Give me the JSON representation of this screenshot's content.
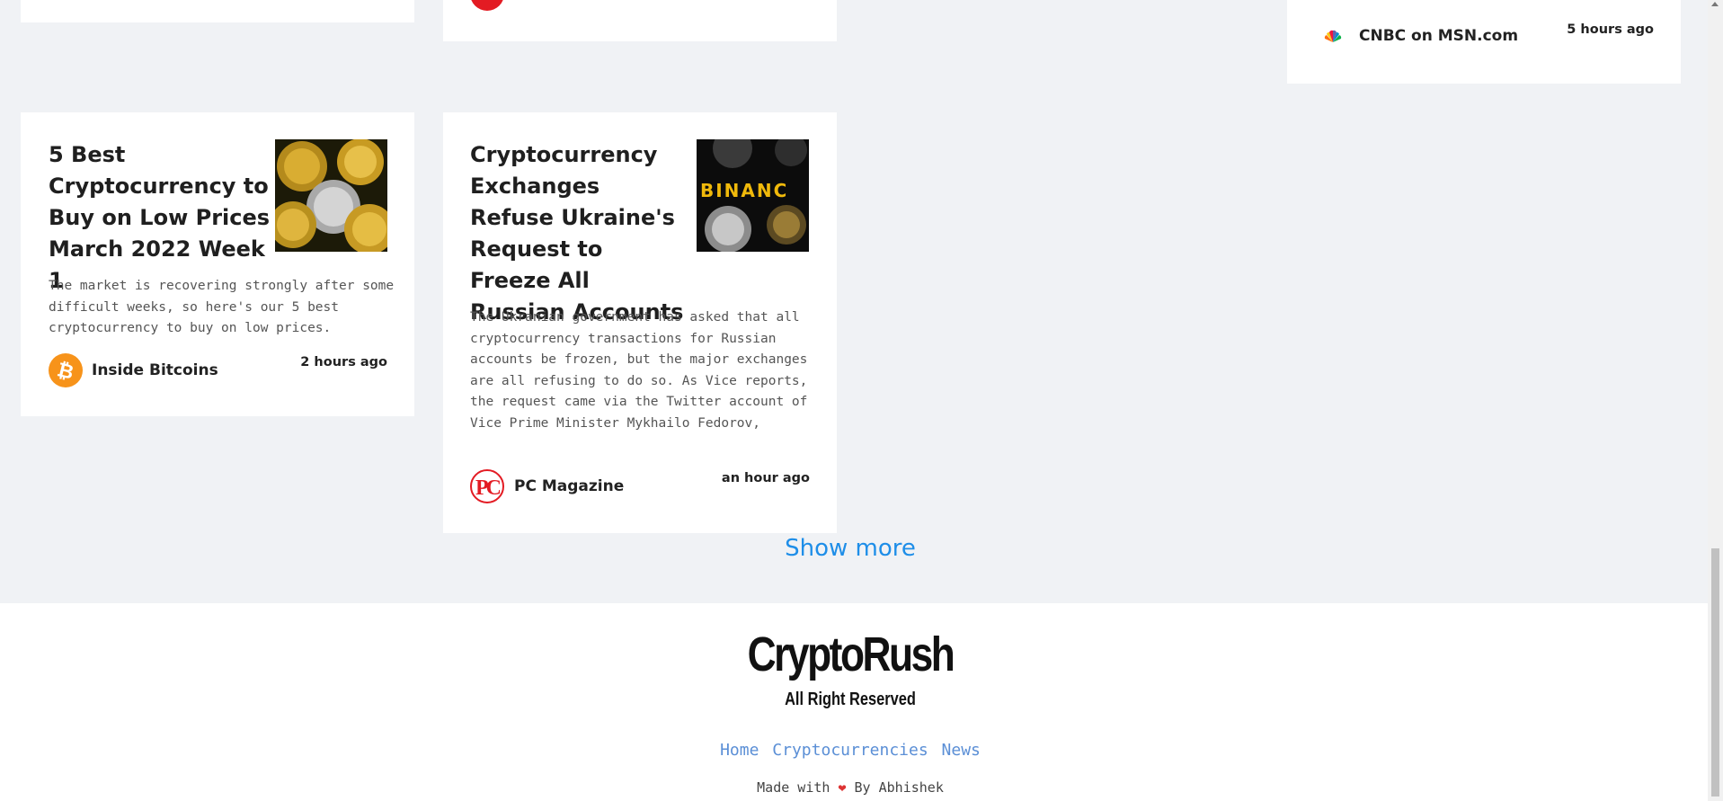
{
  "cards_top": {
    "right": {
      "source": "CNBC on MSN.com",
      "time": "5 hours ago"
    }
  },
  "cards": [
    {
      "title": "5 Best Cryptocurrency to Buy on Low Prices March 2022 Week 1",
      "description": "The market is recovering strongly after some difficult weeks, so here's our 5 best cryptocurrency to buy on low prices.",
      "source": "Inside Bitcoins",
      "time": "2 hours ago"
    },
    {
      "title": "Cryptocurrency Exchanges Refuse Ukraine's Request to Freeze All Russian Accounts",
      "description": "The Ukranian government has asked that all cryptocurrency transactions for Russian accounts be frozen, but the major exchanges are all refusing to do so. As Vice reports, the request came via the Twitter account of Vice Prime Minister Mykhailo Fedorov,",
      "source": "PC Magazine",
      "time": "an hour ago"
    }
  ],
  "show_more_label": "Show more",
  "footer": {
    "brand": "CryptoRush",
    "rights": "All Right Reserved",
    "links": [
      "Home",
      "Cryptocurrencies",
      "News"
    ],
    "credit_prefix": "Made with",
    "credit_suffix": "By Abhishek"
  },
  "colors": {
    "accent": "#1e8ee8",
    "link": "#5b8fd6",
    "page_bg": "#f0f2f5",
    "bitcoin_orange": "#f7931a",
    "pc_red": "#e31b23"
  },
  "icons": {
    "bitcoin": "bitcoin-logo-icon",
    "pc_magazine": "pc-magazine-logo-icon",
    "cnbc": "cnbc-peacock-icon",
    "heart": "heart-icon"
  }
}
